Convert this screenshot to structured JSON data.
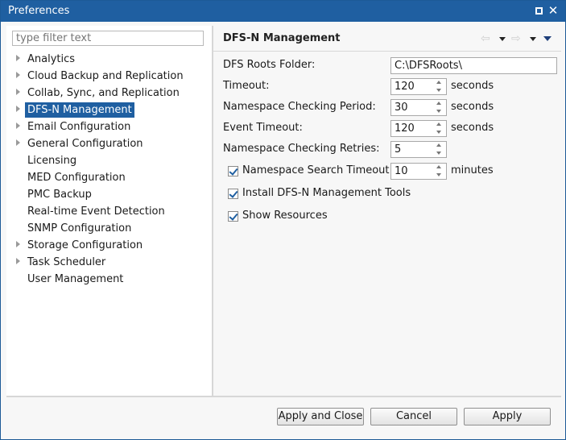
{
  "window": {
    "title": "Preferences"
  },
  "filter": {
    "placeholder": "type filter text",
    "value": ""
  },
  "tree": {
    "items": [
      {
        "label": "Analytics",
        "expandable": true
      },
      {
        "label": "Cloud Backup and Replication",
        "expandable": true
      },
      {
        "label": "Collab, Sync, and Replication",
        "expandable": true
      },
      {
        "label": "DFS-N Management",
        "expandable": true,
        "selected": true
      },
      {
        "label": "Email Configuration",
        "expandable": true
      },
      {
        "label": "General Configuration",
        "expandable": true
      },
      {
        "label": "Licensing",
        "expandable": false
      },
      {
        "label": "MED Configuration",
        "expandable": false
      },
      {
        "label": "PMC Backup",
        "expandable": false
      },
      {
        "label": "Real-time Event Detection",
        "expandable": false
      },
      {
        "label": "SNMP Configuration",
        "expandable": false
      },
      {
        "label": "Storage Configuration",
        "expandable": true
      },
      {
        "label": "Task Scheduler",
        "expandable": true
      },
      {
        "label": "User Management",
        "expandable": false
      }
    ]
  },
  "page": {
    "title": "DFS-N Management",
    "roots_folder": {
      "label": "DFS Roots Folder:",
      "value": "C:\\DFSRoots\\"
    },
    "timeout": {
      "label": "Timeout:",
      "value": "120",
      "unit": "seconds"
    },
    "ns_period": {
      "label": "Namespace Checking Period:",
      "value": "30",
      "unit": "seconds"
    },
    "event_timeout": {
      "label": "Event Timeout:",
      "value": "120",
      "unit": "seconds"
    },
    "ns_retries": {
      "label": "Namespace Checking Retries:",
      "value": "5"
    },
    "ns_search_timeout": {
      "label": "Namespace Search Timeout:",
      "value": "10",
      "unit": "minutes",
      "checked": true
    },
    "install_tools": {
      "label": "Install DFS-N Management Tools",
      "checked": true
    },
    "show_resources": {
      "label": "Show Resources",
      "checked": true
    }
  },
  "buttons": {
    "apply_close": "Apply and Close",
    "cancel": "Cancel",
    "apply": "Apply"
  },
  "colors": {
    "titlebar": "#1f5fa1",
    "selection": "#1f5fa1",
    "checkmark": "#1f5fa1"
  }
}
